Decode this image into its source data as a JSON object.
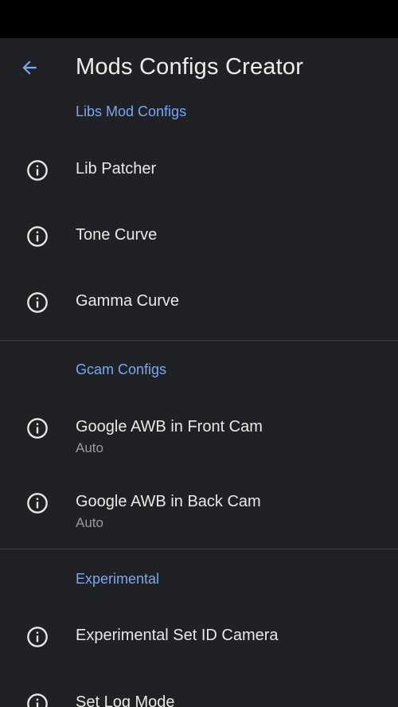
{
  "app_bar": {
    "title": "Mods Configs Creator",
    "back_icon": "arrow-left-icon"
  },
  "colors": {
    "background": "#202125",
    "status_bar": "#000000",
    "accent": "#7aa7f2",
    "primary_text": "#e8e8e8",
    "secondary_text": "#9a9a9e",
    "divider": "#3b3c40"
  },
  "sections": [
    {
      "header": "Libs Mod Configs",
      "items": [
        {
          "title": "Lib Patcher",
          "icon": "info-icon"
        },
        {
          "title": "Tone Curve",
          "icon": "info-icon"
        },
        {
          "title": "Gamma Curve",
          "icon": "info-icon"
        }
      ]
    },
    {
      "header": "Gcam Configs",
      "items": [
        {
          "title": "Google AWB in Front Cam",
          "summary": "Auto",
          "icon": "info-icon"
        },
        {
          "title": "Google AWB in Back Cam",
          "summary": "Auto",
          "icon": "info-icon"
        }
      ]
    },
    {
      "header": "Experimental",
      "items": [
        {
          "title": "Experimental Set ID Camera",
          "icon": "info-icon"
        },
        {
          "title": "Set Log Mode",
          "icon": "info-icon"
        }
      ]
    }
  ]
}
